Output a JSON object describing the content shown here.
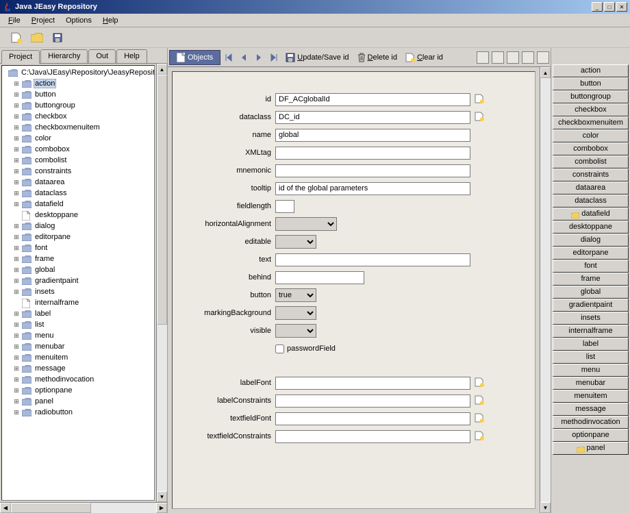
{
  "window": {
    "title": "Java JEasy Repository"
  },
  "menu": {
    "file": "File",
    "project": "Project",
    "options": "Options",
    "help": "Help"
  },
  "left_tabs": {
    "project": "Project",
    "hierarchy": "Hierarchy",
    "out": "Out",
    "help": "Help"
  },
  "tree": {
    "root": "C:\\Java\\JEasy\\Repository\\JeasyRepository",
    "items": [
      "action",
      "button",
      "buttongroup",
      "checkbox",
      "checkboxmenuitem",
      "color",
      "combobox",
      "combolist",
      "constraints",
      "dataarea",
      "dataclass",
      "datafield",
      "desktoppane",
      "dialog",
      "editorpane",
      "font",
      "frame",
      "global",
      "gradientpaint",
      "insets",
      "internalframe",
      "label",
      "list",
      "menu",
      "menubar",
      "menuitem",
      "message",
      "methodinvocation",
      "optionpane",
      "panel",
      "radiobutton"
    ],
    "leaf_docs": [
      "desktoppane",
      "internalframe"
    ],
    "selected": "action"
  },
  "center_toolbar": {
    "objects": "Objects",
    "update_save": "Update/Save id",
    "delete": "Delete id",
    "clear": "Clear id"
  },
  "form": {
    "labels": {
      "id": "id",
      "dataclass": "dataclass",
      "name": "name",
      "xmltag": "XMLtag",
      "mnemonic": "mnemonic",
      "tooltip": "tooltip",
      "fieldlength": "fieldlength",
      "horizontalAlignment": "horizontalAlignment",
      "editable": "editable",
      "text": "text",
      "behind": "behind",
      "button": "button",
      "markingBackground": "markingBackground",
      "visible": "visible",
      "passwordField": "passwordField",
      "labelFont": "labelFont",
      "labelConstraints": "labelConstraints",
      "textfieldFont": "textfieldFont",
      "textfieldConstraints": "textfieldConstraints"
    },
    "values": {
      "id": "DF_ACglobalId",
      "dataclass": "DC_id",
      "name": "global",
      "xmltag": "",
      "mnemonic": "",
      "tooltip": "id of the global parameters",
      "fieldlength": "",
      "horizontalAlignment": "",
      "editable": "",
      "text": "",
      "behind": "",
      "button": "true",
      "markingBackground": "",
      "visible": "",
      "passwordField": false,
      "labelFont": "",
      "labelConstraints": "",
      "textfieldFont": "",
      "textfieldConstraints": ""
    }
  },
  "right_panel": {
    "items": [
      "action",
      "button",
      "buttongroup",
      "checkbox",
      "checkboxmenuitem",
      "color",
      "combobox",
      "combolist",
      "constraints",
      "dataarea",
      "dataclass",
      "datafield",
      "desktoppane",
      "dialog",
      "editorpane",
      "font",
      "frame",
      "global",
      "gradientpaint",
      "insets",
      "internalframe",
      "label",
      "list",
      "menu",
      "menubar",
      "menuitem",
      "message",
      "methodinvocation",
      "optionpane",
      "panel"
    ],
    "highlighted": "datafield"
  }
}
